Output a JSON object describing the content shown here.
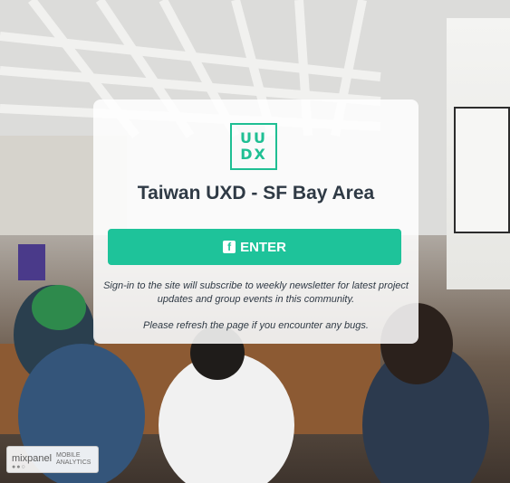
{
  "logo": {
    "text_top": "UU",
    "text_bottom": "DX"
  },
  "title": "Taiwan UXD - SF Bay Area",
  "enter_button": {
    "icon": "facebook-icon",
    "label": "ENTER"
  },
  "signin_note": "Sign-in to the site will subscribe to weekly newsletter for latest project updates and group events in this community.",
  "refresh_note": "Please refresh the page if you encounter any bugs.",
  "badge": {
    "brand": "mixpanel",
    "dots": "●●○",
    "line1": "MOBILE",
    "line2": "ANALYTICS"
  },
  "colors": {
    "accent": "#1ec39a",
    "title": "#2f3a45"
  }
}
